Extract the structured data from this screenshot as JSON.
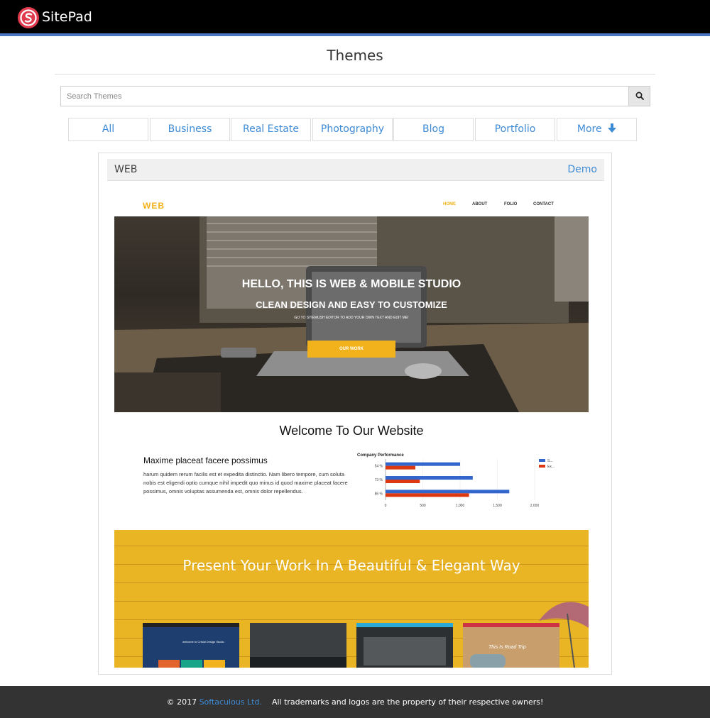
{
  "header": {
    "brand": "SitePad",
    "logo_icon": "sitepad-logo-icon",
    "accent_color": "#4a76c1"
  },
  "page": {
    "title": "Themes"
  },
  "search": {
    "placeholder": "Search Themes",
    "value": "",
    "icon": "search-icon"
  },
  "tabs": [
    {
      "label": "All"
    },
    {
      "label": "Business"
    },
    {
      "label": "Real Estate"
    },
    {
      "label": "Photography"
    },
    {
      "label": "Blog"
    },
    {
      "label": "Portfolio"
    },
    {
      "label": "More",
      "icon": "arrow-down-icon"
    }
  ],
  "theme": {
    "name": "WEB",
    "demo_label": "Demo",
    "preview": {
      "logo": "WEB",
      "nav": [
        "HOME",
        "ABOUT",
        "FOLIO",
        "CONTACT"
      ],
      "hero_title": "HELLO, THIS IS WEB & MOBILE STUDIO",
      "hero_subtitle": "CLEAN DESIGN AND EASY TO CUSTOMIZE",
      "hero_small": "GO TO SITEMUSH EDITOR TO ADD YOUR OWN TEXT AND EDIT ME!",
      "hero_button": "OUR WORK",
      "welcome": "Welcome To Our Website",
      "section_heading": "Maxime placeat facere possimus",
      "section_text": "harum quidem rerum facilis est et expedita distinctio. Nam libero tempore, cum soluta nobis est eligendi optio cumque nihil impedit quo minus id quod maxime placeat facere possimus, omnis voluptas assumenda est, omnis dolor repellendus.",
      "banner_title": "Present Your Work In A Beautiful & Elegant Way",
      "thumbnail_text": [
        "welcome to Cristal Design Studio",
        "This Is Road Trip"
      ]
    }
  },
  "chart_data": {
    "type": "bar",
    "orientation": "horizontal",
    "title": "Company Performance",
    "categories": [
      "54 %",
      "73 %",
      "86 %"
    ],
    "series": [
      {
        "name": "S...",
        "color": "#3366cc",
        "values": [
          1000,
          1170,
          1660
        ]
      },
      {
        "name": "Ex...",
        "color": "#dc3912",
        "values": [
          400,
          460,
          1120
        ]
      }
    ],
    "x_ticks": [
      "0",
      "500",
      "1,000",
      "1,500",
      "2,000"
    ],
    "xlim": [
      0,
      2000
    ],
    "legend_position": "right"
  },
  "footer": {
    "copyright": "© 2017",
    "company": "Softaculous Ltd.",
    "notice": "All trademarks and logos are the property of their respective owners!"
  }
}
